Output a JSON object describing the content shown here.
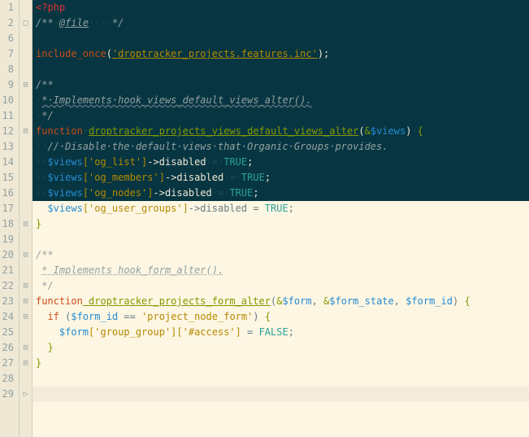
{
  "editor": {
    "line_numbers": [
      "1",
      "2",
      "6",
      "7",
      "8",
      "9",
      "10",
      "11",
      "12",
      "13",
      "14",
      "15",
      "16",
      "17",
      "18",
      "19",
      "20",
      "21",
      "22",
      "23",
      "24",
      "25",
      "26",
      "27",
      "28",
      "29"
    ],
    "fold_marks": [
      "",
      "▢",
      "",
      "",
      "",
      "⊟",
      "",
      "",
      "⊟",
      "",
      "",
      "",
      "",
      "",
      "⊟",
      "",
      "⊟",
      "",
      "⊟",
      "⊟",
      "⊟",
      "",
      "⊟",
      "⊟",
      "",
      "▷"
    ],
    "lines": {
      "l1": {
        "open_tag": "<?php"
      },
      "l2": {
        "cmt_open": "/**",
        "spaces": "·",
        "atfile": "@file",
        "dots": "····",
        "cmt_close": "*/"
      },
      "l7": {
        "inc": "include_once",
        "paren_o": "(",
        "str": "'droptracker_projects.features.inc'",
        "paren_c": ")",
        "semi": ";"
      },
      "l9": {
        "cmt": "/**"
      },
      "l10": {
        "indent": "·",
        "txt": "*·Implements·hook_views_default_views_alter()."
      },
      "l11": {
        "indent": "·",
        "cmt": "*/"
      },
      "l12": {
        "fn": "function",
        "sp": "·",
        "name": "droptracker_projects_views_default_views_alter",
        "po": "(",
        "amp": "&",
        "var": "$views",
        "pc": ")",
        "sp2": "·",
        "br": "{"
      },
      "l13": {
        "indent": "··",
        "cmt": "//·Disable·the·default·views·that·Organic·Groups·provides."
      },
      "l14": {
        "indent": "··",
        "var": "$views",
        "key": "['og_list']",
        "arrow": "->disabled",
        "eq": "·=·",
        "val": "TRUE",
        "semi": ";"
      },
      "l15": {
        "indent": "··",
        "var": "$views",
        "key": "['og_members']",
        "arrow": "->disabled",
        "eq": "·=·",
        "val": "TRUE",
        "semi": ";"
      },
      "l16": {
        "indent": "··",
        "var": "$views",
        "key": "['og_nodes']",
        "arrow": "->disabled",
        "eq": "·=·",
        "val": "TRUE",
        "semi": ";"
      },
      "l17": {
        "indent": "  ",
        "var": "$views",
        "key": "['og_user_groups']",
        "arrow": "->disabled",
        "eq": " = ",
        "val": "TRUE",
        "semi": ";"
      },
      "l18": {
        "br": "}"
      },
      "l20": {
        "cmt": "/**"
      },
      "l21": {
        "indent": " ",
        "txt": "* Implements hook_form_alter()."
      },
      "l22": {
        "indent": " ",
        "cmt": "*/"
      },
      "l23": {
        "fn": "function",
        "name": " droptracker_projects_form_alter",
        "po": "(",
        "amp": "&",
        "v1": "$form",
        "c1": ", ",
        "amp2": "&",
        "v2": "$form_state",
        "c2": ", ",
        "v3": "$form_id",
        "pc": ") ",
        "br": "{"
      },
      "l24": {
        "indent": "  ",
        "if": "if ",
        "po": "(",
        "var": "$form_id",
        "eq": " == ",
        "str": "'project_node_form'",
        "pc": ") ",
        "br": "{"
      },
      "l25": {
        "indent": "    ",
        "var": "$form",
        "k1": "['group_group']",
        "k2": "['#access']",
        "eq": " = ",
        "val": "FALSE",
        "semi": ";"
      },
      "l26": {
        "indent": "  ",
        "br": "}"
      },
      "l27": {
        "br": "}"
      }
    }
  }
}
